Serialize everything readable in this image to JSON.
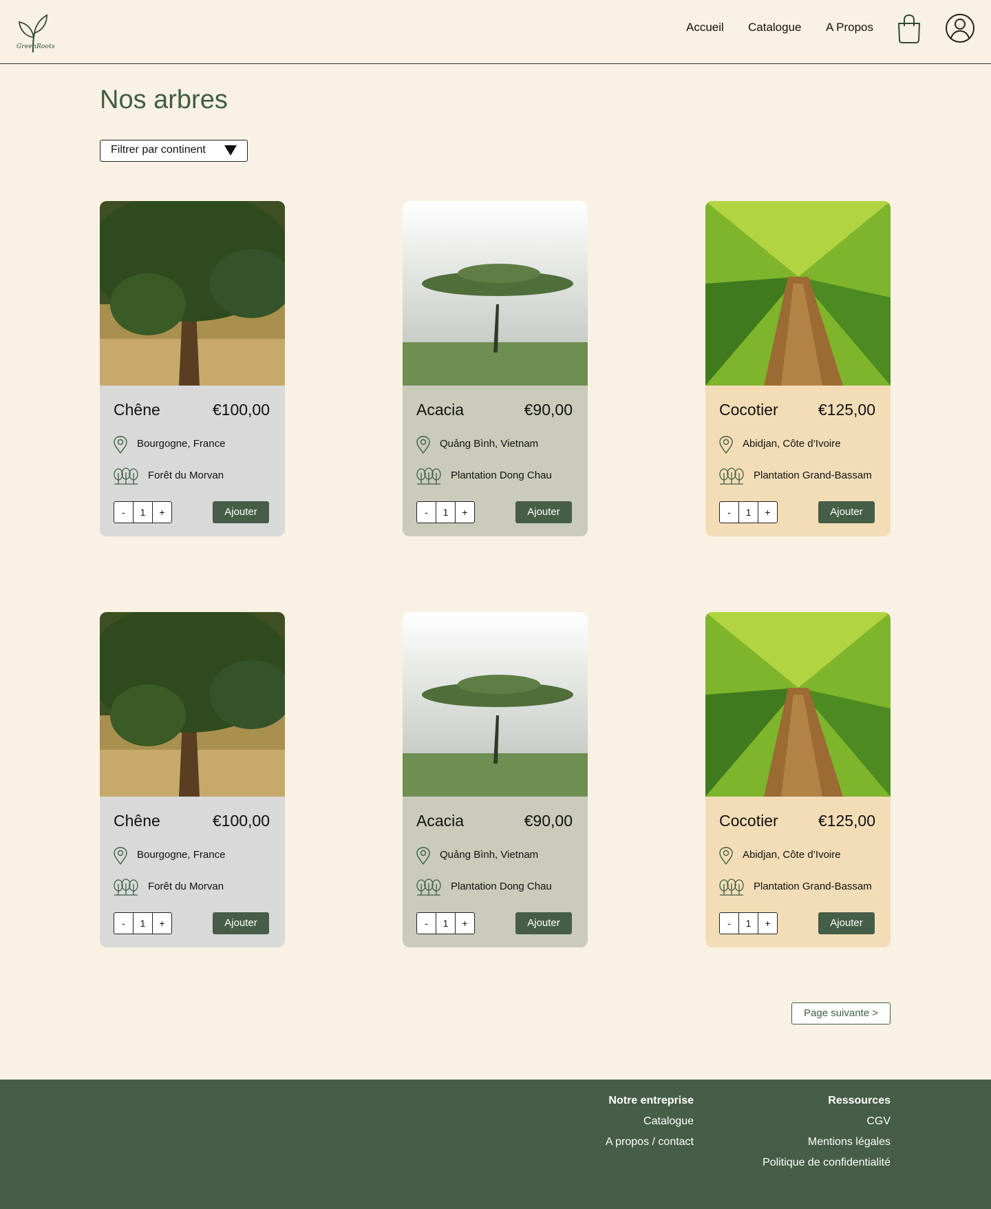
{
  "header": {
    "logo_text": "GreenRoots",
    "nav": [
      "Accueil",
      "Catalogue",
      "A Propos"
    ],
    "cart_icon": "shopping-bag-icon",
    "user_icon": "user-circle-icon"
  },
  "main": {
    "title": "Nos arbres",
    "filter_label": "Filtrer par continent",
    "next_page": "Page suivante >"
  },
  "cards": [
    {
      "name": "Chêne",
      "price": "€100,00",
      "location": "Bourgogne, France",
      "forest": "Forêt du Morvan",
      "qty": "1",
      "minus": "-",
      "plus": "+",
      "add": "Ajouter",
      "bg": "#d9d9d9"
    },
    {
      "name": "Acacia",
      "price": "€90,00",
      "location": "Quảng Bình, Vietnam",
      "forest": "Plantation Dong Chau",
      "qty": "1",
      "minus": "-",
      "plus": "+",
      "add": "Ajouter",
      "bg": "#cacbbb"
    },
    {
      "name": "Cocotier",
      "price": "€125,00",
      "location": "Abidjan, Côte d’Ivoire",
      "forest": "Plantation Grand-Bassam",
      "qty": "1",
      "minus": "-",
      "plus": "+",
      "add": "Ajouter",
      "bg": "#f3ddb7"
    },
    {
      "name": "Chêne",
      "price": "€100,00",
      "location": "Bourgogne, France",
      "forest": "Forêt du Morvan",
      "qty": "1",
      "minus": "-",
      "plus": "+",
      "add": "Ajouter",
      "bg": "#d9d9d9"
    },
    {
      "name": "Acacia",
      "price": "€90,00",
      "location": "Quảng Bình, Vietnam",
      "forest": "Plantation Dong Chau",
      "qty": "1",
      "minus": "-",
      "plus": "+",
      "add": "Ajouter",
      "bg": "#cacbbb"
    },
    {
      "name": "Cocotier",
      "price": "€125,00",
      "location": "Abidjan, Côte d’Ivoire",
      "forest": "Plantation Grand-Bassam",
      "qty": "1",
      "minus": "-",
      "plus": "+",
      "add": "Ajouter",
      "bg": "#f3ddb7"
    }
  ],
  "footer": {
    "col1": {
      "title": "Notre entreprise",
      "links": [
        "Catalogue",
        "A propos / contact"
      ]
    },
    "col2": {
      "title": "Ressources",
      "links": [
        "CGV",
        "Mentions légales",
        "Politique de confidentialité"
      ]
    }
  },
  "colors": {
    "brand_green": "#465d47",
    "title_green": "#3f5e44",
    "background": "#f9f1e3"
  }
}
